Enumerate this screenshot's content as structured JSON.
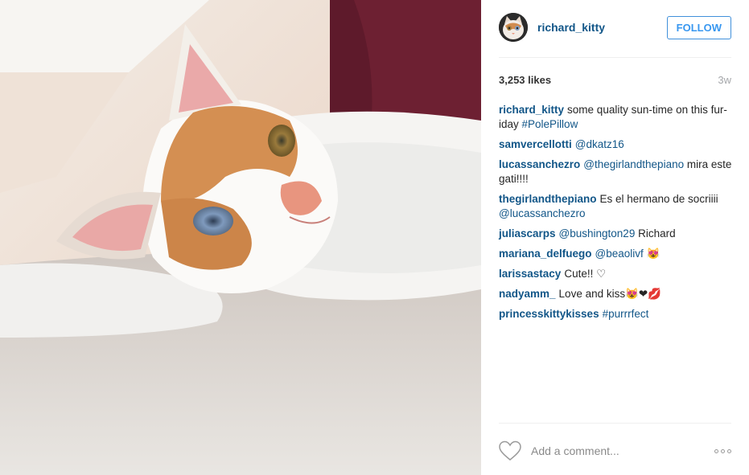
{
  "post": {
    "username": "richard_kitty",
    "follow_label": "FOLLOW",
    "likes": "3,253 likes",
    "age": "3w",
    "add_comment_placeholder": "Add a comment...",
    "photo_alt": "cat lying on carpet"
  },
  "comments": [
    {
      "user": "richard_kitty",
      "parts": [
        {
          "t": "some quality sun-time on this fur-iday "
        },
        {
          "t": "#PolePillow",
          "link": true
        }
      ]
    },
    {
      "user": "samvercellotti",
      "parts": [
        {
          "t": "@dkatz16",
          "link": true
        }
      ]
    },
    {
      "user": "lucassanchezro",
      "parts": [
        {
          "t": "@thegirlandthepiano",
          "link": true
        },
        {
          "t": " mira este gati!!!!"
        }
      ]
    },
    {
      "user": "thegirlandthepiano",
      "parts": [
        {
          "t": "Es el hermano de socriiii "
        },
        {
          "t": "@lucassanchezro",
          "link": true
        }
      ]
    },
    {
      "user": "juliascarps",
      "parts": [
        {
          "t": "@bushington29",
          "link": true
        },
        {
          "t": " Richard"
        }
      ]
    },
    {
      "user": "mariana_delfuego",
      "parts": [
        {
          "t": "@beaolivf",
          "link": true
        },
        {
          "t": " 😻"
        }
      ]
    },
    {
      "user": "larissastacy",
      "parts": [
        {
          "t": "Cute!! ♡"
        }
      ]
    },
    {
      "user": "nadyamm_",
      "parts": [
        {
          "t": "Love and kiss😻❤💋"
        }
      ]
    },
    {
      "user": "princesskittykisses",
      "parts": [
        {
          "t": "#purrrfect",
          "link": true
        }
      ]
    }
  ],
  "colors": {
    "link": "#125688",
    "follow": "#3897f0"
  },
  "icons": [
    "heart-icon",
    "more-options-icon"
  ]
}
